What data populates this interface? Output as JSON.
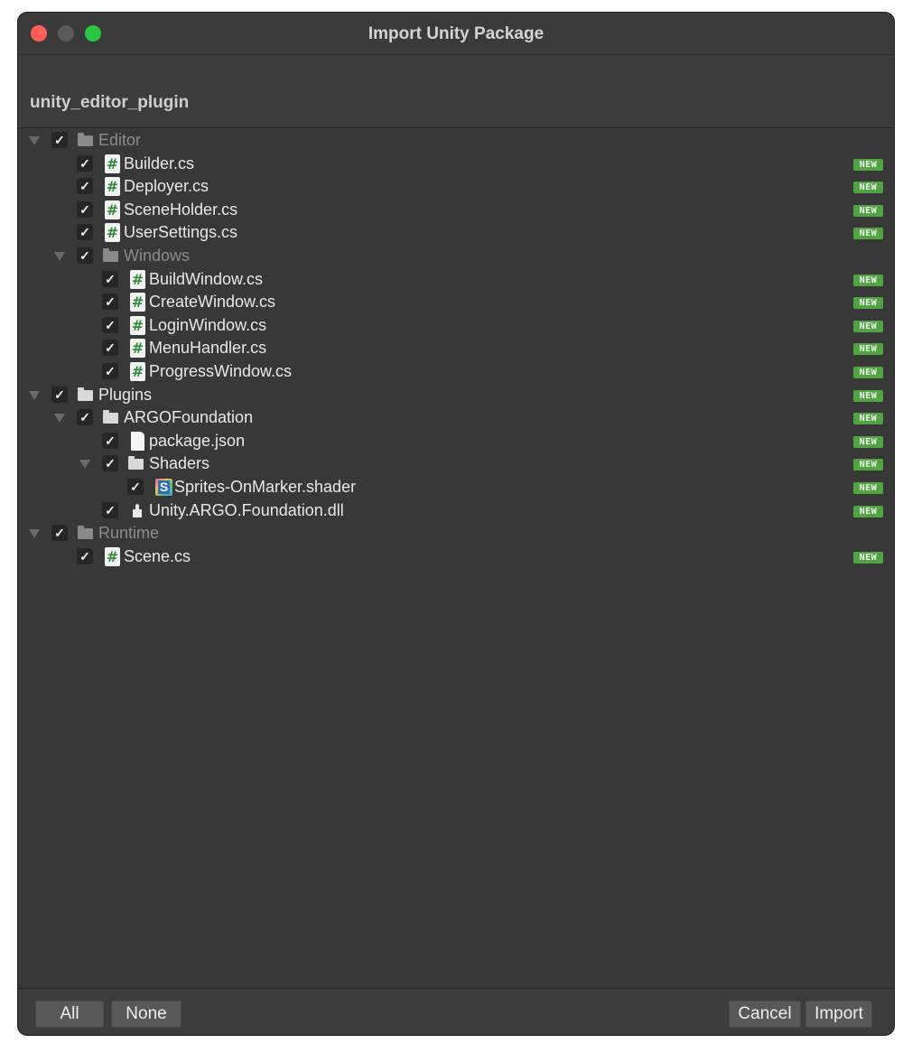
{
  "window": {
    "title": "Import Unity Package",
    "package_name": "unity_editor_plugin"
  },
  "tree": [
    {
      "label": "Editor",
      "depth": 0,
      "kind": "folder",
      "expandable": true,
      "checked": true,
      "dim": true,
      "badge": ""
    },
    {
      "label": "Builder.cs",
      "depth": 1,
      "kind": "cs",
      "expandable": false,
      "checked": true,
      "dim": false,
      "badge": "NEW"
    },
    {
      "label": "Deployer.cs",
      "depth": 1,
      "kind": "cs",
      "expandable": false,
      "checked": true,
      "dim": false,
      "badge": "NEW"
    },
    {
      "label": "SceneHolder.cs",
      "depth": 1,
      "kind": "cs",
      "expandable": false,
      "checked": true,
      "dim": false,
      "badge": "NEW"
    },
    {
      "label": "UserSettings.cs",
      "depth": 1,
      "kind": "cs",
      "expandable": false,
      "checked": true,
      "dim": false,
      "badge": "NEW"
    },
    {
      "label": "Windows",
      "depth": 1,
      "kind": "folder",
      "expandable": true,
      "checked": true,
      "dim": true,
      "badge": ""
    },
    {
      "label": "BuildWindow.cs",
      "depth": 2,
      "kind": "cs",
      "expandable": false,
      "checked": true,
      "dim": false,
      "badge": "NEW"
    },
    {
      "label": "CreateWindow.cs",
      "depth": 2,
      "kind": "cs",
      "expandable": false,
      "checked": true,
      "dim": false,
      "badge": "NEW"
    },
    {
      "label": "LoginWindow.cs",
      "depth": 2,
      "kind": "cs",
      "expandable": false,
      "checked": true,
      "dim": false,
      "badge": "NEW"
    },
    {
      "label": "MenuHandler.cs",
      "depth": 2,
      "kind": "cs",
      "expandable": false,
      "checked": true,
      "dim": false,
      "badge": "NEW"
    },
    {
      "label": "ProgressWindow.cs",
      "depth": 2,
      "kind": "cs",
      "expandable": false,
      "checked": true,
      "dim": false,
      "badge": "NEW"
    },
    {
      "label": "Plugins",
      "depth": 0,
      "kind": "folder",
      "expandable": true,
      "checked": true,
      "dim": false,
      "badge": "NEW"
    },
    {
      "label": "ARGOFoundation",
      "depth": 1,
      "kind": "folder",
      "expandable": true,
      "checked": true,
      "dim": false,
      "badge": "NEW"
    },
    {
      "label": "package.json",
      "depth": 2,
      "kind": "doc",
      "expandable": false,
      "checked": true,
      "dim": false,
      "badge": "NEW"
    },
    {
      "label": "Shaders",
      "depth": 2,
      "kind": "folder",
      "expandable": true,
      "checked": true,
      "dim": false,
      "badge": "NEW"
    },
    {
      "label": "Sprites-OnMarker.shader",
      "depth": 3,
      "kind": "shader",
      "expandable": false,
      "checked": true,
      "dim": false,
      "badge": "NEW"
    },
    {
      "label": "Unity.ARGO.Foundation.dll",
      "depth": 2,
      "kind": "dll",
      "expandable": false,
      "checked": true,
      "dim": false,
      "badge": "NEW"
    },
    {
      "label": "Runtime",
      "depth": 0,
      "kind": "folder",
      "expandable": true,
      "checked": true,
      "dim": true,
      "badge": ""
    },
    {
      "label": "Scene.cs",
      "depth": 1,
      "kind": "cs",
      "expandable": false,
      "checked": true,
      "dim": false,
      "badge": "NEW"
    }
  ],
  "footer": {
    "all_label": "All",
    "none_label": "None",
    "cancel_label": "Cancel",
    "import_label": "Import"
  },
  "colors": {
    "background": "#383838",
    "badge": "#4fa63f",
    "close": "#ff5f57",
    "zoom": "#28c840"
  }
}
